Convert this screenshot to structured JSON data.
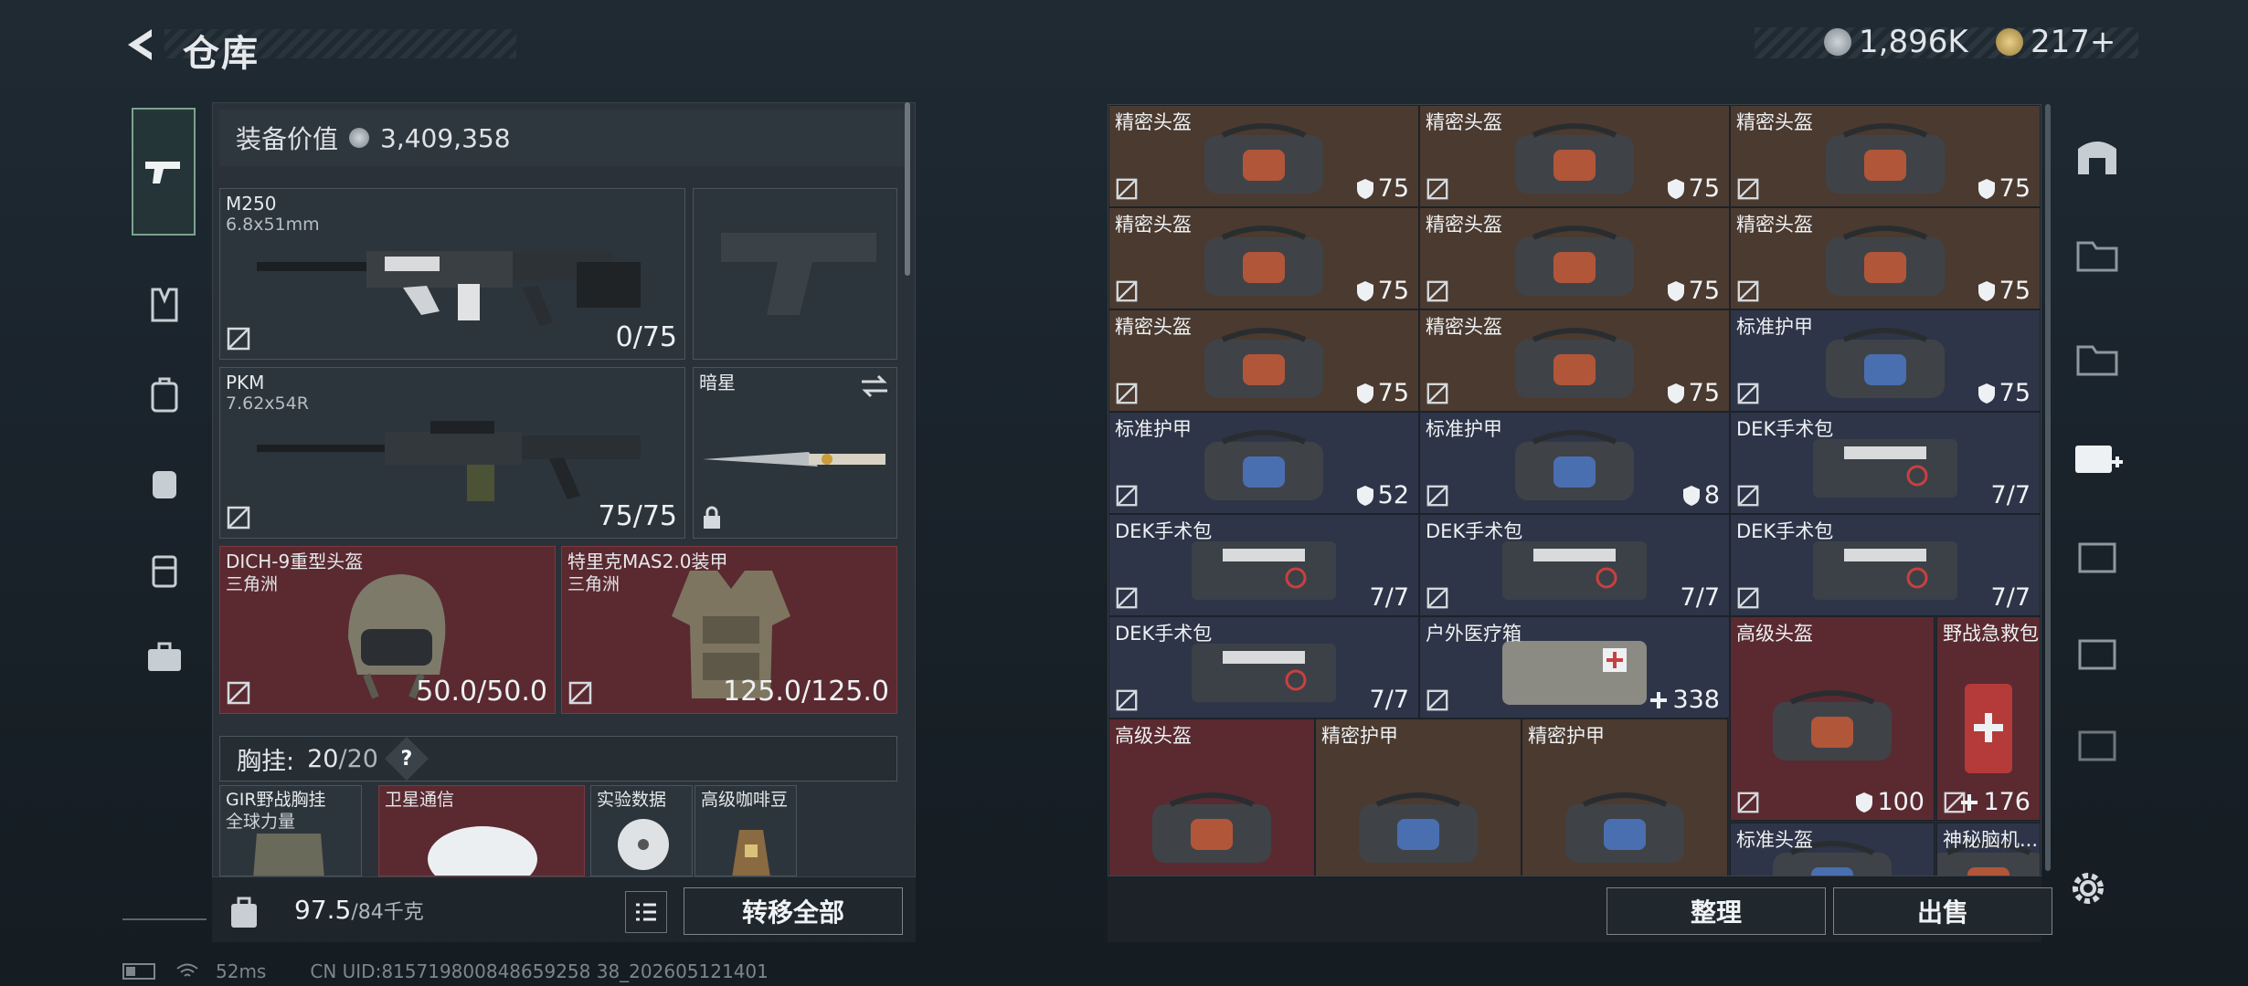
{
  "header": {
    "title": "仓库"
  },
  "currency": {
    "silver": "1,896K",
    "gold": "217+"
  },
  "equipment": {
    "value_label": "装备价值",
    "value": "3,409,358",
    "primary": {
      "name": "M250",
      "caliber": "6.8x51mm",
      "ammo": "0/75"
    },
    "secondary": {
      "name": "PKM",
      "caliber": "7.62x54R",
      "ammo": "75/75"
    },
    "melee": {
      "name": "暗星"
    },
    "helmet": {
      "name": "DICH-9重型头盔",
      "origin": "三角洲",
      "durability": "50.0/50.0"
    },
    "armor": {
      "name": "特里克MAS2.0装甲",
      "origin": "三角洲",
      "durability": "125.0/125.0"
    },
    "chest": {
      "label": "胸挂:",
      "capacity": "20",
      "max": "/20",
      "help": "?"
    },
    "chest_items": [
      {
        "name": "GIR野战胸挂",
        "sub": "全球力量"
      },
      {
        "name": "卫星通信"
      },
      {
        "name": "实验数据"
      },
      {
        "name": "高级咖啡豆"
      }
    ]
  },
  "weight": {
    "current": "97.5",
    "max": "/84千克"
  },
  "actions": {
    "transfer_all": "转移全部",
    "organize": "整理",
    "sell": "出售"
  },
  "stash": [
    {
      "name": "精密头盔",
      "value": "75",
      "kind": "shield",
      "color": "brown"
    },
    {
      "name": "精密头盔",
      "value": "75",
      "kind": "shield",
      "color": "brown"
    },
    {
      "name": "精密头盔",
      "value": "75",
      "kind": "shield",
      "color": "brown"
    },
    {
      "name": "精密头盔",
      "value": "75",
      "kind": "shield",
      "color": "brown"
    },
    {
      "name": "精密头盔",
      "value": "75",
      "kind": "shield",
      "color": "brown"
    },
    {
      "name": "精密头盔",
      "value": "75",
      "kind": "shield",
      "color": "brown"
    },
    {
      "name": "精密头盔",
      "value": "75",
      "kind": "shield",
      "color": "brown"
    },
    {
      "name": "精密头盔",
      "value": "75",
      "kind": "shield",
      "color": "brown"
    },
    {
      "name": "标准护甲",
      "value": "75",
      "kind": "shield",
      "color": "blue"
    },
    {
      "name": "标准护甲",
      "value": "52",
      "kind": "shield",
      "color": "blue"
    },
    {
      "name": "标准护甲",
      "value": "8",
      "kind": "shield",
      "color": "blue"
    },
    {
      "name": "DEK手术包",
      "value": "7/7",
      "kind": "none",
      "color": "blue"
    },
    {
      "name": "DEK手术包",
      "value": "7/7",
      "kind": "none",
      "color": "blue"
    },
    {
      "name": "DEK手术包",
      "value": "7/7",
      "kind": "none",
      "color": "blue"
    },
    {
      "name": "DEK手术包",
      "value": "7/7",
      "kind": "none",
      "color": "blue"
    },
    {
      "name": "DEK手术包",
      "value": "7/7",
      "kind": "none",
      "color": "blue"
    },
    {
      "name": "户外医疗箱",
      "value": "338",
      "kind": "plus",
      "color": "blue"
    },
    {
      "name": "高级头盔",
      "value": "100",
      "kind": "shield",
      "color": "red"
    },
    {
      "name": "野战急救包",
      "value": "176",
      "kind": "plus",
      "color": "red"
    },
    {
      "name": "高级头盔",
      "value": "",
      "kind": "none",
      "color": "red"
    },
    {
      "name": "精密护甲",
      "value": "",
      "kind": "none",
      "color": "brown"
    },
    {
      "name": "精密护甲",
      "value": "",
      "kind": "none",
      "color": "brown"
    },
    {
      "name": "标准头盔",
      "value": "",
      "kind": "none",
      "color": "blue"
    },
    {
      "name": "神秘脑机...",
      "value": "",
      "kind": "none",
      "color": "blue"
    }
  ],
  "status": {
    "ping": "52ms",
    "uid": "CN UID:815719800848659258 38_202605121401"
  },
  "colors": {
    "accent": "#7ca28e",
    "brown": "#4b3a30",
    "blue": "#2f3548",
    "red": "#5a2a30"
  }
}
